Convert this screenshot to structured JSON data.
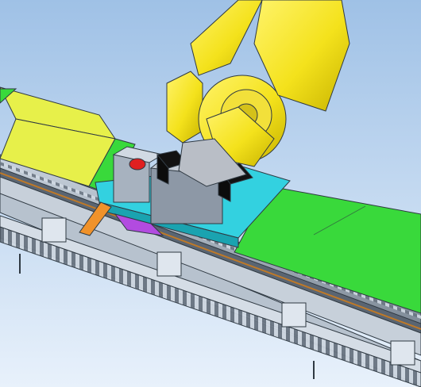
{
  "scene": {
    "description_visible_text": "",
    "colors": {
      "background_top": "#9fc1e6",
      "background_bottom": "#e8f1fb",
      "robot_yellow": "#f4e21c",
      "robot_shadow": "#c7b300",
      "plate_green": "#39d93b",
      "plate_yellow": "#e7f04a",
      "carriage_cyan": "#33d1e0",
      "rail_gray": "#9aa6b4",
      "rail_dark": "#4e5966",
      "orange_bracket": "#f0922a",
      "purple_part": "#b24be0",
      "red_button": "#e02020",
      "black_box": "#121212"
    }
  }
}
